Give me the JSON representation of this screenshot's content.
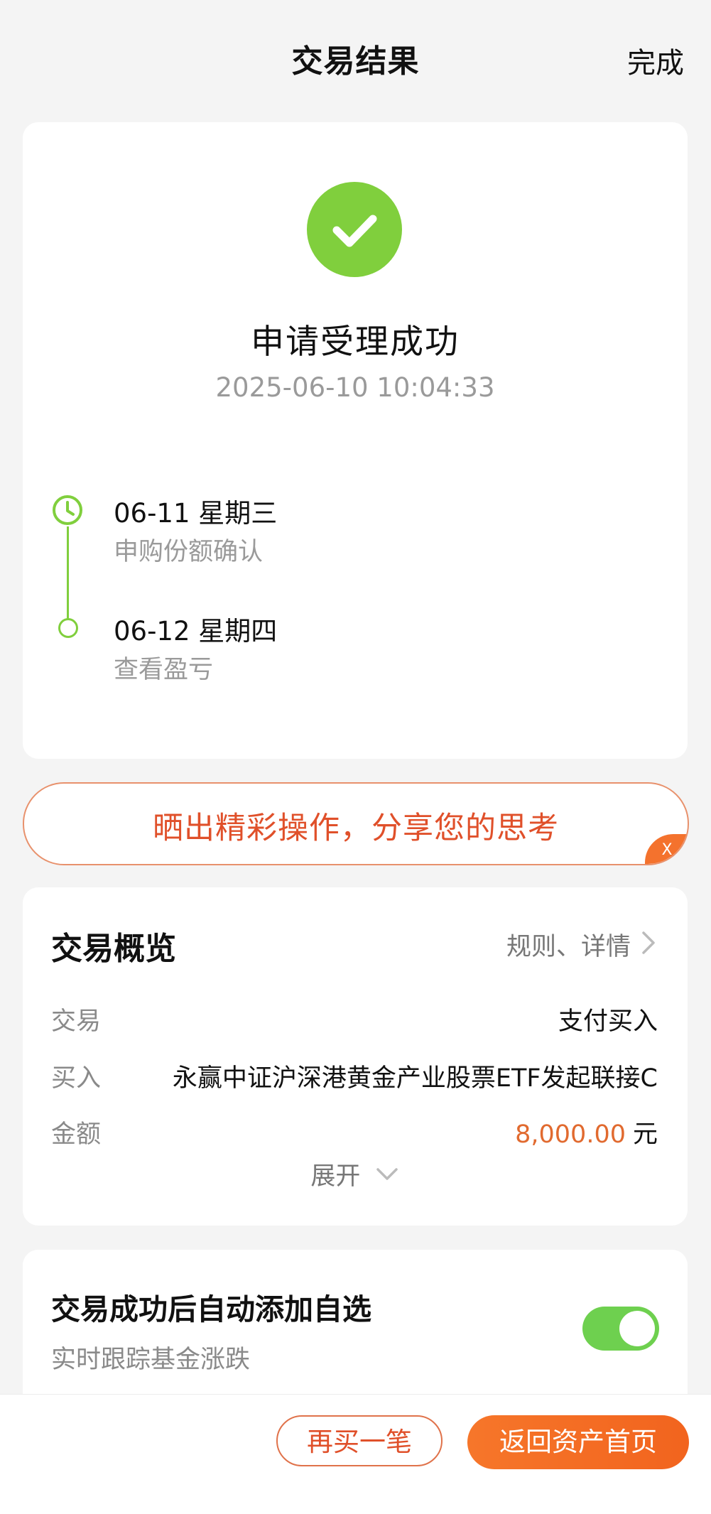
{
  "header": {
    "title": "交易结果",
    "done_label": "完成"
  },
  "result": {
    "status_icon": "check-circle-icon",
    "title": "申请受理成功",
    "time": "2025-06-10 10:04:33",
    "timeline": [
      {
        "date": "06-11  星期三",
        "desc": "申购份额确认",
        "icon": "clock-icon"
      },
      {
        "date": "06-12  星期四",
        "desc": "查看盈亏",
        "icon": "circle-dot-icon"
      }
    ]
  },
  "share": {
    "text": "晒出精彩操作，分享您的思考",
    "close_label": "X"
  },
  "overview": {
    "title": "交易概览",
    "link_label": "规则、详情",
    "rows": [
      {
        "label": "交易",
        "value": "支付买入"
      },
      {
        "label": "买入",
        "value": "永赢中证沪深港黄金产业股票ETF发起联接C"
      },
      {
        "label": "金额",
        "amount": "8,000.00",
        "unit": "元"
      }
    ],
    "expand_label": "展开"
  },
  "auto_add": {
    "title": "交易成功后自动添加自选",
    "subtitle": "实时跟踪基金涨跌",
    "toggle_on": true
  },
  "bottom": {
    "buy_again_label": "再买一笔",
    "home_label": "返回资产首页"
  },
  "colors": {
    "accent": "#f4722d",
    "success": "#80cf3d",
    "toggle": "#6ed04f",
    "amount": "#e16a2f"
  }
}
